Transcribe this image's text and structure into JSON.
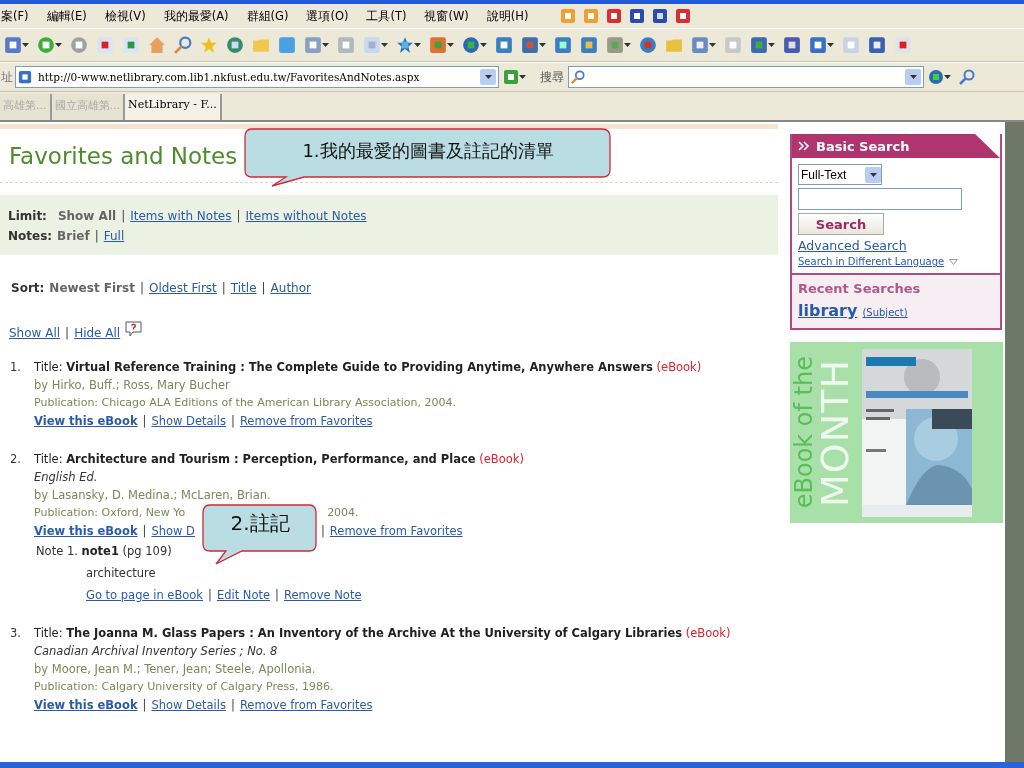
{
  "menu_bar": [
    "案(F)",
    "編輯(E)",
    "檢視(V)",
    "我的最愛(A)",
    "群組(G)",
    "選項(O)",
    "工具(T)",
    "視窗(W)",
    "說明(H)"
  ],
  "address_bar": {
    "label": "址",
    "url": "http://0-www.netlibrary.com.lib1.nkfust.edu.tw/FavoritesAndNotes.aspx"
  },
  "search_bar": {
    "label": "搜尋"
  },
  "tabs": [
    {
      "label": "高雄第...",
      "selected": false
    },
    {
      "label": "國立高雄第...",
      "selected": false
    },
    {
      "label": "NetLibrary - F...",
      "selected": true
    }
  ],
  "separator": "|",
  "page": {
    "title": "Favorites and Notes",
    "callouts": [
      "1.我的最愛的圖書及註記的清單",
      "2.註記"
    ],
    "limit": {
      "label": "Limit:",
      "options": [
        {
          "label": "Show All",
          "selected": true
        },
        {
          "label": "Items with Notes",
          "selected": false
        },
        {
          "label": "Items without Notes",
          "selected": false
        }
      ]
    },
    "notes": {
      "label": "Notes:",
      "options": [
        {
          "label": "Brief",
          "selected": true
        },
        {
          "label": "Full",
          "selected": false
        }
      ]
    },
    "sort": {
      "label": "Sort:",
      "options": [
        {
          "label": "Newest First",
          "selected": true
        },
        {
          "label": "Oldest First",
          "selected": false
        },
        {
          "label": "Title",
          "selected": false
        },
        {
          "label": "Author",
          "selected": false
        }
      ]
    },
    "show_hide": [
      "Show All",
      "Hide All"
    ],
    "items": [
      {
        "number": "1.",
        "title_label": "Title:",
        "title": "Virtual Reference Training : The Complete Guide to Providing Anytime, Anywhere Answers",
        "format": "(eBook)",
        "by": "by Hirko, Buff.; Ross, Mary Bucher",
        "publication": [
          "Publication: Chicago ALA Editions of the American Library Association, 2004."
        ],
        "actions": [
          {
            "label": "View this eBook",
            "kind": "primary"
          },
          {
            "label": "Show Details",
            "kind": "link"
          },
          {
            "label": "Remove from Favorites",
            "kind": "link"
          }
        ]
      },
      {
        "number": "2.",
        "title_label": "Title:",
        "title": "Architecture and Tourism : Perception, Performance, and Place",
        "format": "(eBook)",
        "edition": "English Ed.",
        "by": "by Lasansky, D. Medina.; McLaren, Brian.",
        "publication": [
          "Publication: Oxford, New Yo",
          "2004."
        ],
        "actions": [
          {
            "label": "View this eBook",
            "kind": "primary"
          },
          {
            "label": "Show D",
            "kind": "covered"
          },
          {
            "label": "Remove from Favorites",
            "kind": "link"
          }
        ],
        "notes": [
          {
            "label": "Note 1.",
            "title": "note1",
            "page": "(pg 109)",
            "text": "architecture",
            "actions": [
              "Go to page in eBook",
              "Edit Note",
              "Remove Note"
            ]
          }
        ]
      },
      {
        "number": "3.",
        "title_label": "Title:",
        "title": "The Joanna M. Glass Papers : An Inventory of the Archive At the University of Calgary Libraries",
        "format": "(eBook)",
        "edition": "Canadian Archival Inventory Series ; No. 8",
        "by": "by Moore, Jean M.; Tener, Jean; Steele, Apollonia.",
        "publication": [
          "Publication: Calgary University of Calgary Press, 1986."
        ],
        "actions": [
          {
            "label": "View this eBook",
            "kind": "primary"
          },
          {
            "label": "Show Details",
            "kind": "link"
          },
          {
            "label": "Remove from Favorites",
            "kind": "link"
          }
        ]
      }
    ]
  },
  "sidebar": {
    "basic_search": {
      "title": "Basic Search",
      "select": "Full-Text",
      "button": "Search",
      "links": [
        "Advanced Search",
        "Search in Different Language"
      ]
    },
    "recent_searches": {
      "title": "Recent Searches",
      "items": [
        {
          "term": "library",
          "type": "(Subject)"
        }
      ]
    },
    "banner": {
      "line1": "eBook of the",
      "line2": "MONTH"
    }
  }
}
